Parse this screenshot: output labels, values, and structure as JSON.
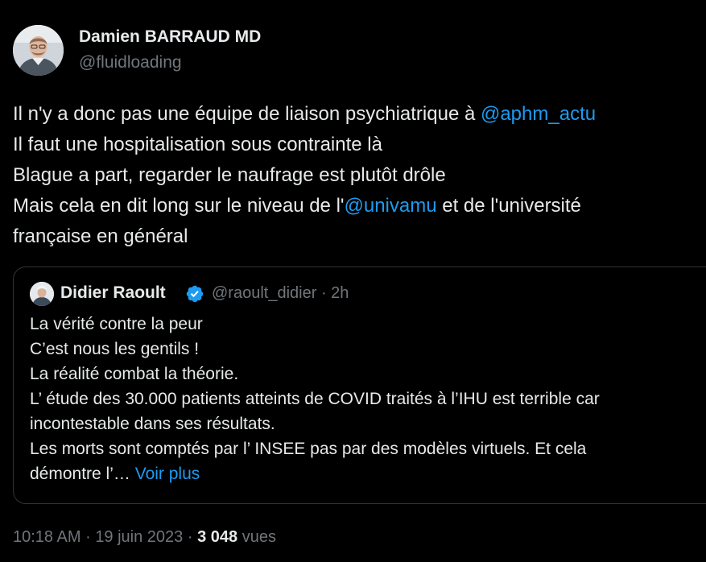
{
  "author": {
    "name": "Damien BARRAUD MD",
    "handle": "@fluidloading",
    "avatar_icon": "person-avatar"
  },
  "tweet": {
    "line1_text": "Il n'y a donc pas une équipe de liaison psychiatrique à ",
    "line1_mention": "@aphm_actu",
    "line2": "Il faut une hospitalisation sous contrainte là",
    "line3": "Blague a part, regarder le naufrage est plutôt drôle",
    "line4_before": "Mais cela en dit long sur le niveau de l'",
    "line4_mention": "@univamu",
    "line4_after": " et de l'université",
    "line5": "française en général"
  },
  "quote": {
    "name": "Didier Raoult",
    "handle": "@raoult_didier",
    "time": "2h",
    "verified_color": "#1d9bf0",
    "lines": [
      "La vérité contre la peur",
      "C’est nous les gentils !",
      "La réalité combat la théorie.",
      "L’ étude des 30.000 patients atteints de COVID traités à l’IHU est terrible car",
      "incontestable dans ses résultats.",
      "Les morts sont comptés par l’ INSEE pas par des modèles virtuels. Et cela"
    ],
    "last_line": "démontre l’…",
    "see_more": "Voir plus"
  },
  "meta": {
    "time": "10:18 AM",
    "date": "19 juin 2023",
    "views_count": "3 048",
    "views_label": "vues",
    "separator": "·"
  },
  "colors": {
    "background": "#000000",
    "text": "#e7e9ea",
    "secondary": "#71767b",
    "link": "#1d9bf0",
    "border": "#2f3336"
  }
}
